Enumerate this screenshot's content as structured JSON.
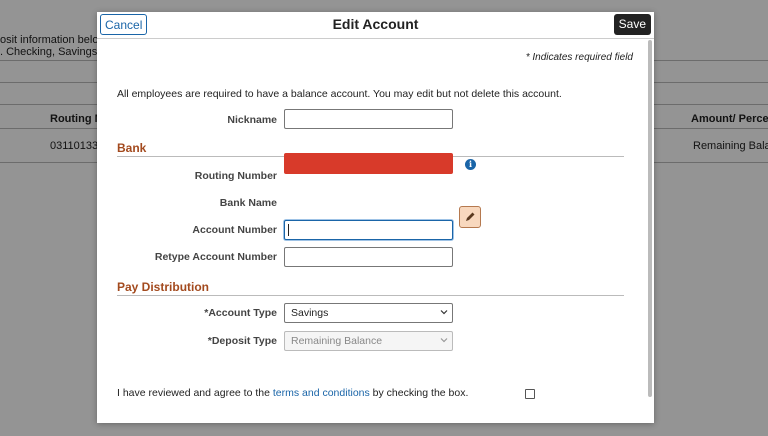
{
  "background": {
    "text_line1": "osit information below.",
    "text_line2": ". Checking, Savings, a",
    "col_routing": "Routing N",
    "col_amount": "Amount/ Percen",
    "row_routing": "03110133",
    "row_amount": "Remaining Balan"
  },
  "modal": {
    "cancel_label": "Cancel",
    "title": "Edit Account",
    "save_label": "Save",
    "required_note": "* Indicates required field",
    "info_text": "All employees are required to have a balance account. You may edit but not delete this account.",
    "nickname_label": "Nickname",
    "nickname_value": "",
    "bank_section": "Bank",
    "routing_label": "Routing Number",
    "bank_name_label": "Bank Name",
    "account_number_label": "Account Number",
    "account_number_value": "",
    "retype_label": "Retype Account Number",
    "retype_value": "",
    "pay_section": "Pay Distribution",
    "account_type_label": "*Account Type",
    "account_type_value": "Savings",
    "deposit_type_label": "*Deposit Type",
    "deposit_type_value": "Remaining Balance",
    "terms_prefix": "I have reviewed and agree to the ",
    "terms_link": "terms and conditions",
    "terms_suffix": " by checking the box.",
    "info_icon_glyph": "i"
  },
  "colors": {
    "accent": "#1a65a8",
    "section": "#a34a1e",
    "redacted": "#d83a2a"
  }
}
